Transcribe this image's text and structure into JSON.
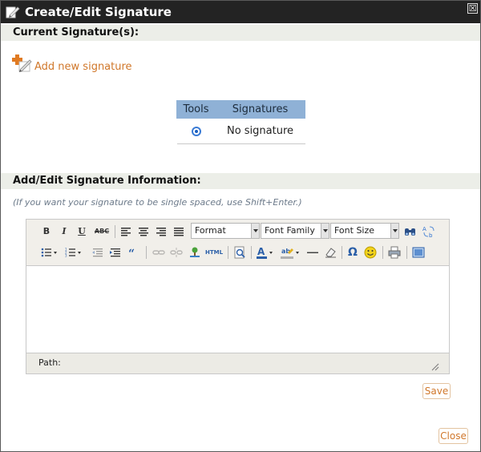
{
  "dialog": {
    "title": "Create/Edit Signature",
    "close_glyph": "☒"
  },
  "current": {
    "header": "Current Signature(s):",
    "add_new_label": "Add new signature",
    "table": {
      "columns": [
        "Tools",
        "Signatures"
      ],
      "rows": [
        {
          "selected": true,
          "signature": "No signature"
        }
      ]
    }
  },
  "edit": {
    "header": "Add/Edit Signature Information:",
    "hint": "(If you want your signature to be single spaced, use Shift+Enter.)",
    "toolbar": {
      "bold": "B",
      "italic": "I",
      "underline": "U",
      "strike": "ABC",
      "format": "Format",
      "font_family": "Font Family",
      "font_size": "Font Size",
      "html": "HTML",
      "omega": "Ω"
    },
    "path_label": "Path:"
  },
  "buttons": {
    "save": "Save",
    "close": "Close"
  },
  "colors": {
    "titlebar": "#232323",
    "section_bg": "#eceee8",
    "accent_orange": "#d0772a",
    "table_header": "#8fb1d6"
  }
}
